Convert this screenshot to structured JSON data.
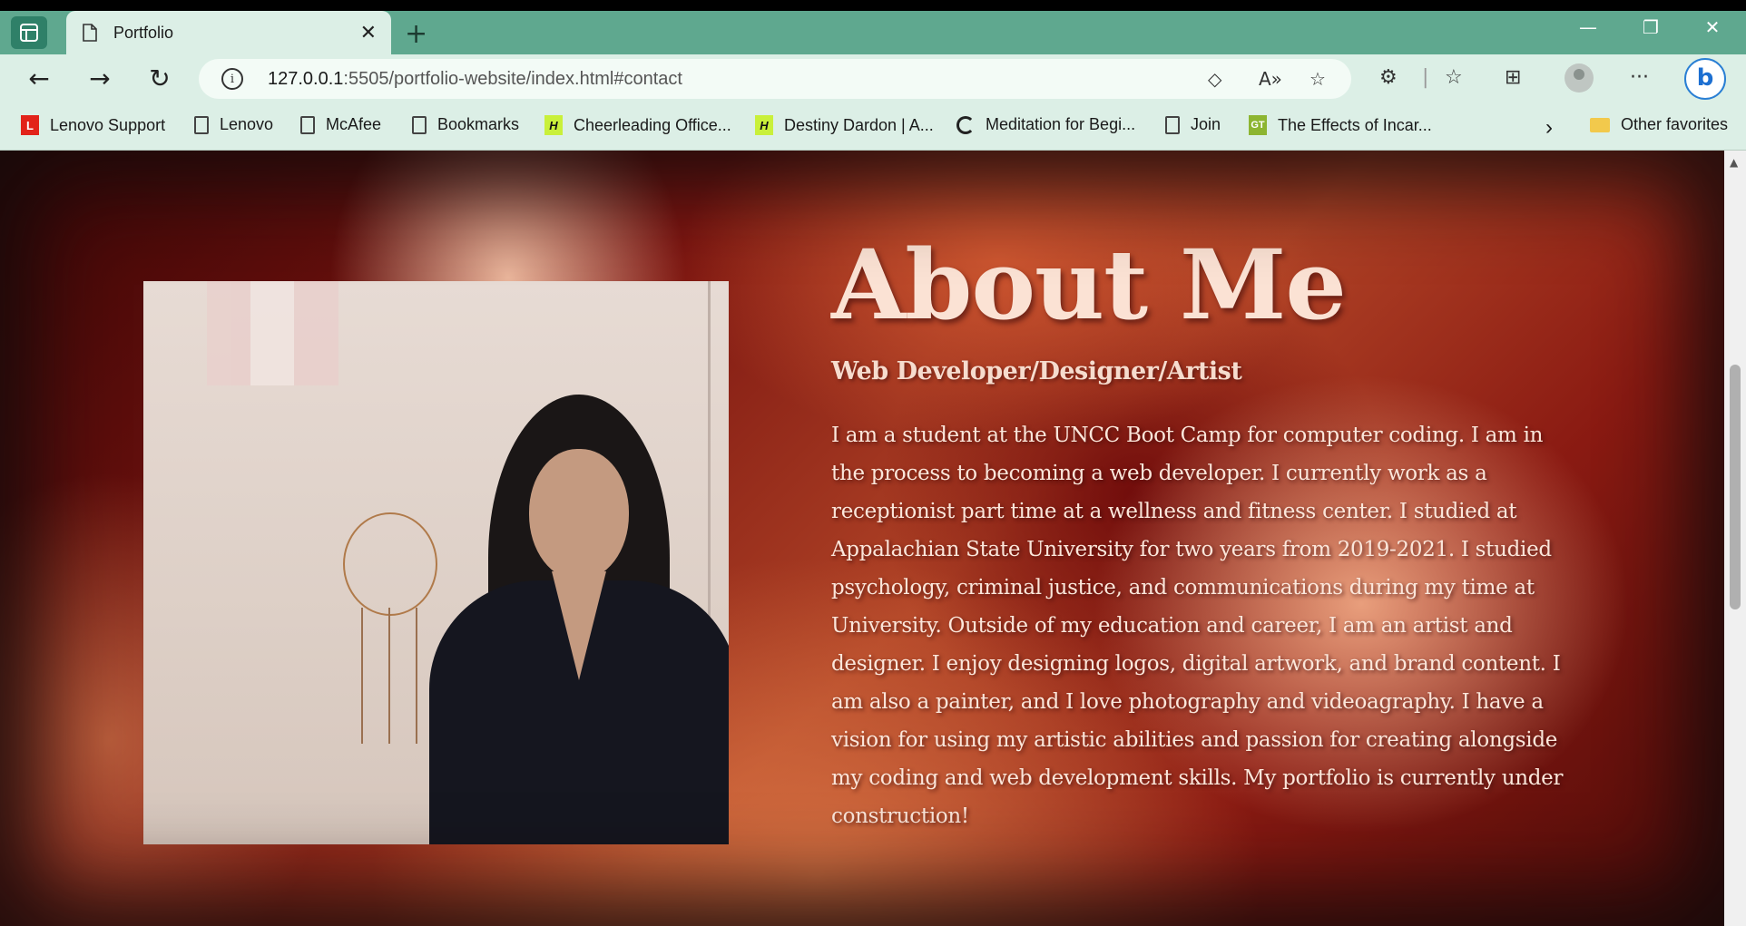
{
  "browser": {
    "tab": {
      "title": "Portfolio"
    },
    "address": {
      "host": "127.0.0.1",
      "rest": ":5505/portfolio-website/index.html#contact"
    },
    "bookmarks": [
      {
        "label": "Lenovo Support",
        "icon": "lenovo-icon"
      },
      {
        "label": "Lenovo",
        "icon": "page-icon"
      },
      {
        "label": "McAfee",
        "icon": "page-icon"
      },
      {
        "label": "Bookmarks",
        "icon": "page-icon"
      },
      {
        "label": "Cheerleading Office...",
        "icon": "h-icon"
      },
      {
        "label": "Destiny Dardon | A...",
        "icon": "h-icon"
      },
      {
        "label": "Meditation for Begi...",
        "icon": "circle-icon"
      },
      {
        "label": "Join",
        "icon": "page-icon"
      },
      {
        "label": "The Effects of Incar...",
        "icon": "gt-icon"
      }
    ],
    "other_favorites": "Other favorites",
    "glyphs": {
      "h": "H",
      "gt": "GT",
      "lenovo": "L",
      "bing": "b"
    }
  },
  "page": {
    "heading": "About Me",
    "subtitle": "Web Developer/Designer/Artist",
    "bio": "I am a student at the UNCC Boot Camp for computer coding. I am in the process to becoming a web developer. I currently work as a receptionist part time at a wellness and fitness center. I studied at Appalachian State University for two years from 2019-2021. I studied psychology, criminal justice, and communications during my time at University. Outside of my education and career, I am an artist and designer. I enjoy designing logos, digital artwork, and brand content. I am also a painter, and I love photography and videoagraphy. I have a vision for using my artistic abilities and passion for creating alongside my coding and web development skills. My portfolio is currently under construction!"
  }
}
